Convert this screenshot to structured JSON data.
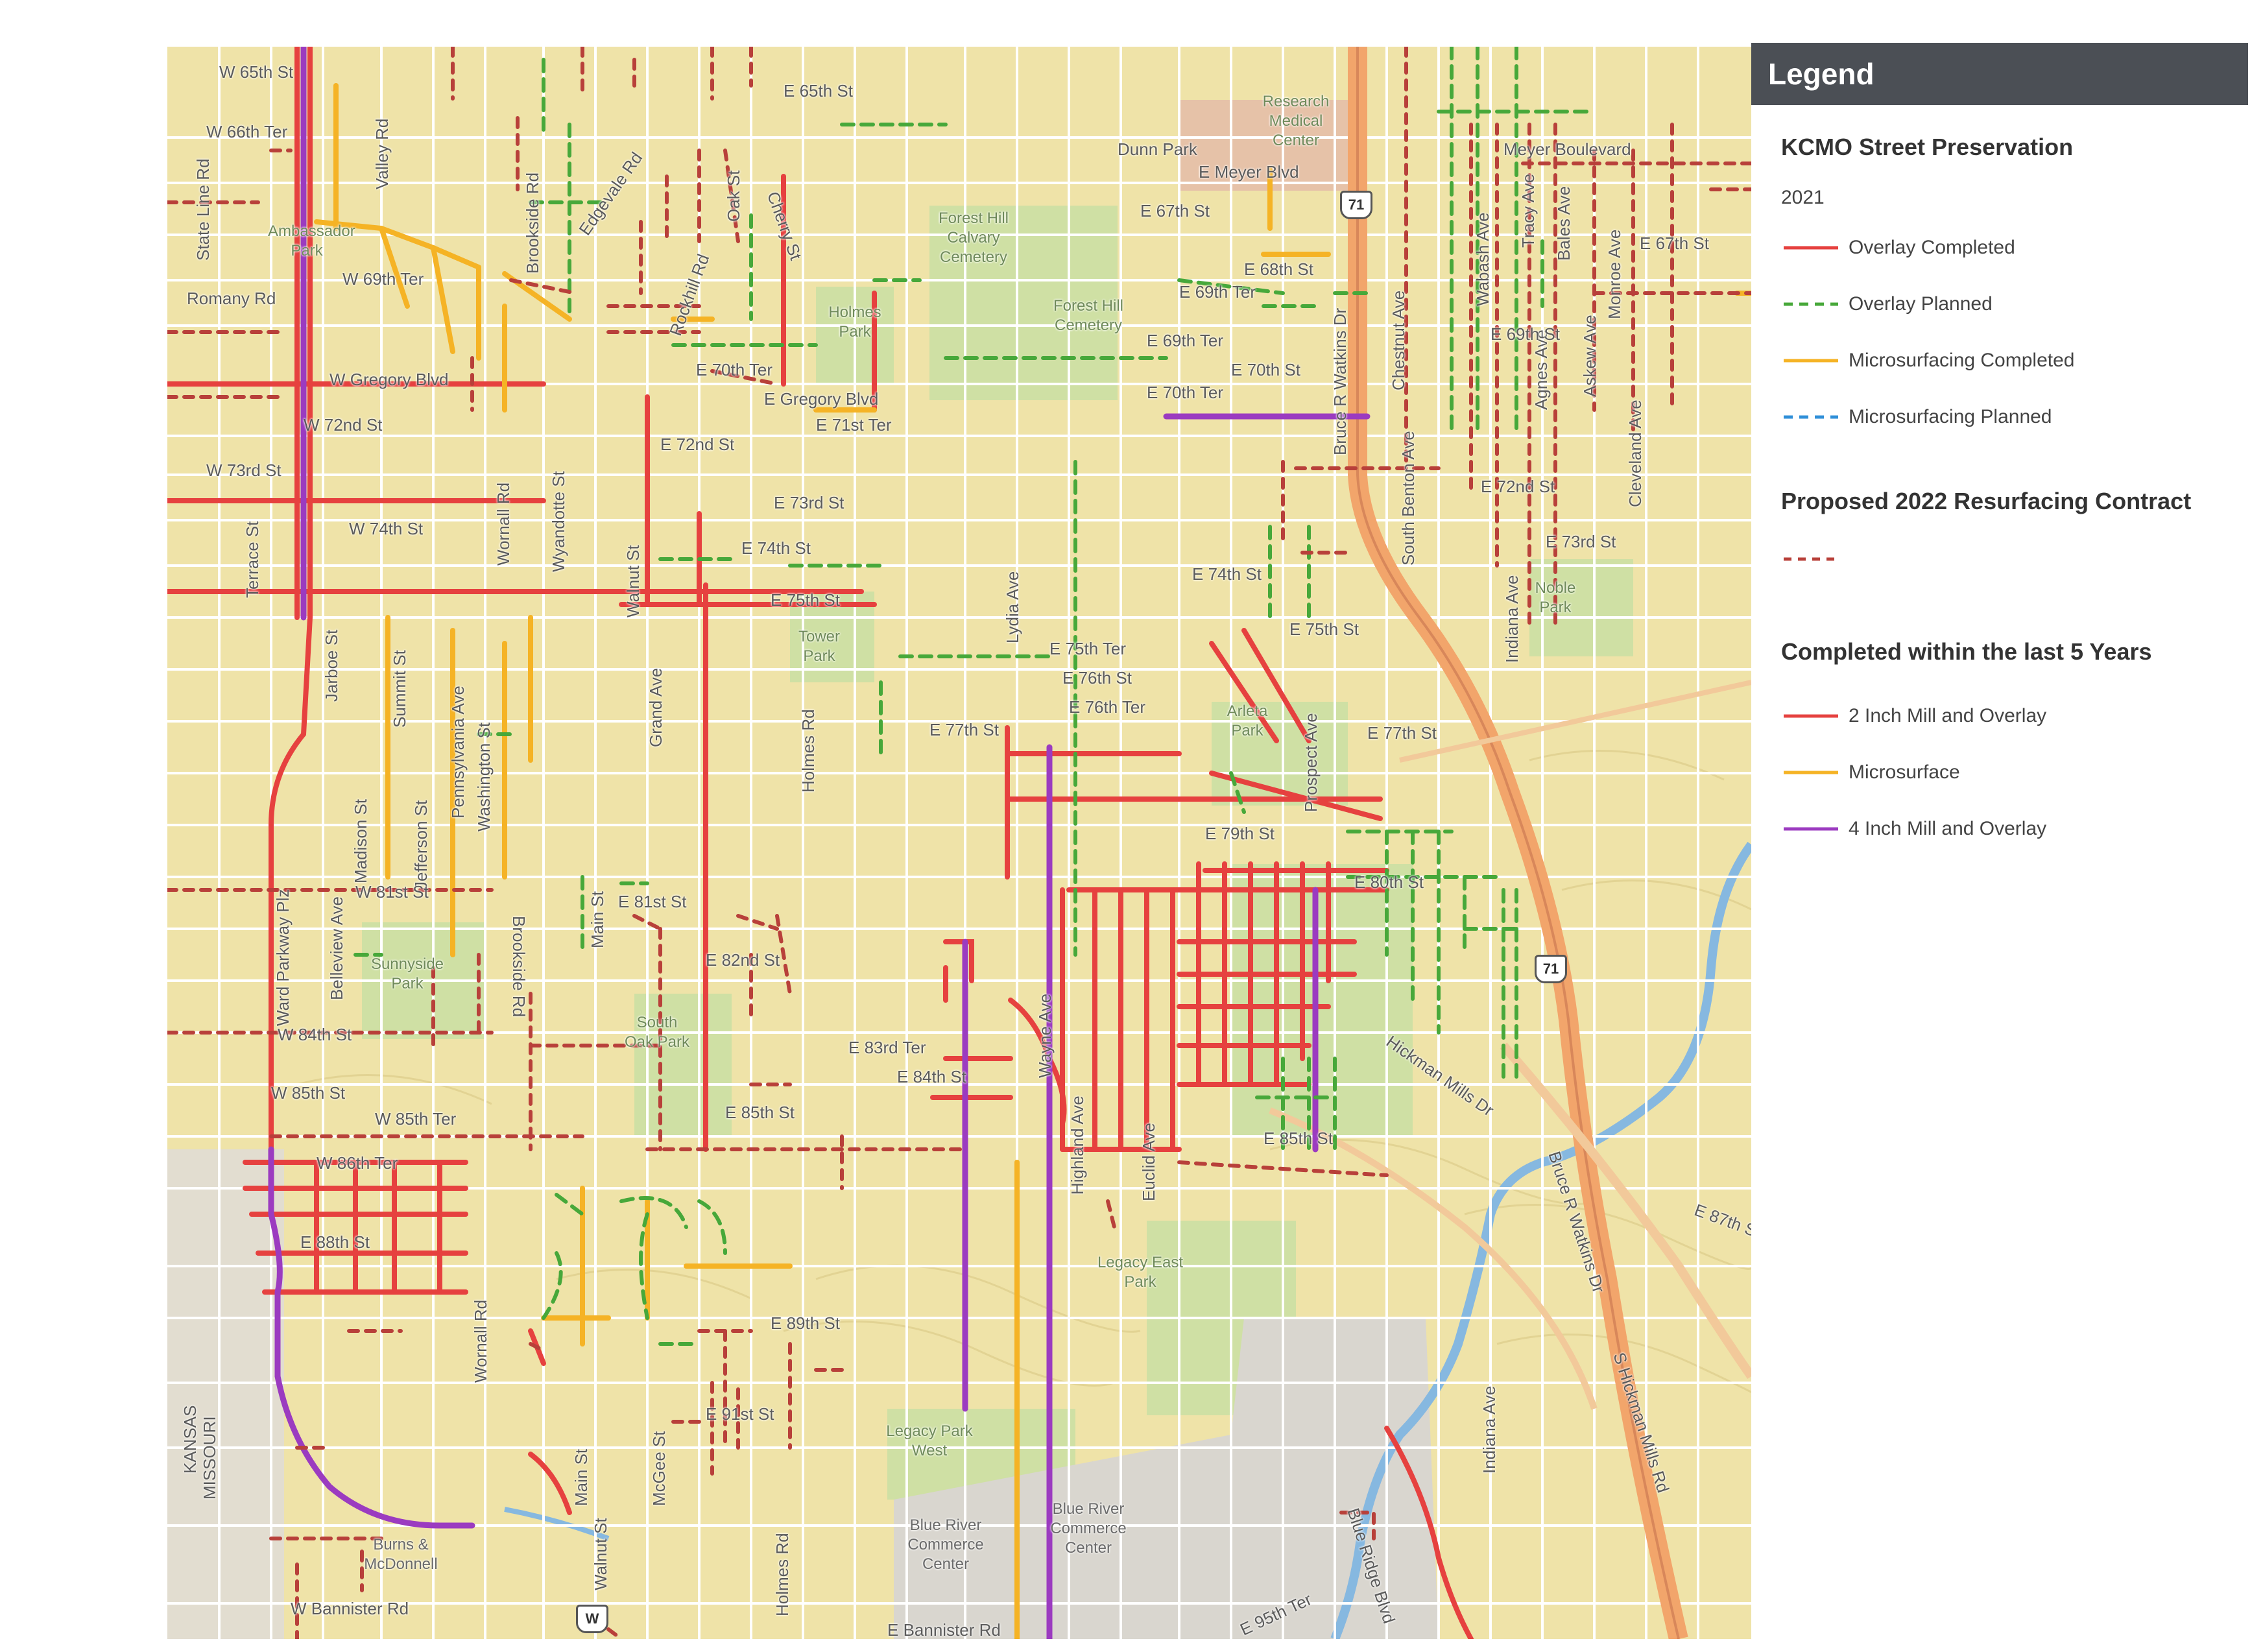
{
  "legend": {
    "header": "Legend",
    "sections": [
      {
        "title": "KCMO Street Preservation",
        "subtitle": "2021",
        "items": [
          {
            "label": "Overlay Completed",
            "color": "#e6413f",
            "style": "solid"
          },
          {
            "label": "Overlay Planned",
            "color": "#47a83a",
            "style": "dashed"
          },
          {
            "label": "Microsurfacing Completed",
            "color": "#f5b325",
            "style": "solid"
          },
          {
            "label": "Microsurfacing Planned",
            "color": "#2f8fd8",
            "style": "dashed"
          }
        ]
      },
      {
        "title": "Proposed 2022 Resurfacing Contract",
        "subtitle": "",
        "items": [
          {
            "label": "",
            "color": "#b8403a",
            "style": "dashed"
          }
        ]
      },
      {
        "title": "Completed within the last 5 Years",
        "subtitle": "",
        "items": [
          {
            "label": "2 Inch Mill and Overlay",
            "color": "#e6413f",
            "style": "solid"
          },
          {
            "label": "Microsurface",
            "color": "#f5b325",
            "style": "solid"
          },
          {
            "label": "4 Inch Mill and Overlay",
            "color": "#9b3bc0",
            "style": "solid"
          }
        ]
      }
    ]
  },
  "map": {
    "colors": {
      "land": "#efe3a8",
      "park": "#cfe0a4",
      "road": "#ffffff",
      "highway": "#f2a56b",
      "commerce": "#d9d6cf",
      "river": "#86b8e0"
    },
    "street_labels": [
      "W 65th St",
      "W 66th Ter",
      "Valley Rd",
      "State Line Rd",
      "Brookside Rd",
      "Edgevale Rd",
      "Oak St",
      "Cherry St",
      "E 65th St",
      "Dunn Park",
      "E Meyer Blvd",
      "Meyer Boulevard",
      "E 67th St",
      "E 68th St",
      "E 69th Ter",
      "E 69th Ter",
      "E 70th St",
      "E 70th Ter",
      "Bruce R Watkins Dr",
      "Chestnut Ave",
      "Wabash Ave",
      "Bales Ave",
      "Monroe Ave",
      "Askew Ave",
      "Cleveland Ave",
      "E 67th St",
      "Romany Rd",
      "W 69th Ter",
      "Rockhill Rd",
      "E 70th Ter",
      "W Gregory Blvd",
      "E Gregory Blvd",
      "E 71st Ter",
      "W 72nd St",
      "W 73rd St",
      "E 72nd St",
      "E 73rd St",
      "E 74th St",
      "E 75th St",
      "Terrace St",
      "W 74th St",
      "Wornall Rd",
      "Wyandotte St",
      "Walnut St",
      "Lydia Ave",
      "E 74th St",
      "E 75th St",
      "E 72nd St",
      "E 73rd St",
      "Indiana Ave",
      "Jarboe St",
      "Summit St",
      "Pennsylvania Ave",
      "Washington St",
      "Grand Ave",
      "Holmes Rd",
      "E 75th Ter",
      "E 76th St",
      "E 76th Ter",
      "E 77th St",
      "Prospect Ave",
      "E 77th St",
      "Madison St",
      "Jefferson St",
      "Brookside Rd",
      "Main St",
      "E 81st St",
      "E 82nd St",
      "Ward Parkway Plz",
      "Belleview Ave",
      "W 81st St",
      "E 79th St",
      "E 80th St",
      "W 84th St",
      "W 85th St",
      "W 85th Ter",
      "W 86th Ter",
      "E 85th St",
      "E 83rd Ter",
      "E 84th St",
      "Wayne Ave",
      "Highland Ave",
      "Euclid Ave",
      "Hickman Mills Dr",
      "E 85th St",
      "Bruce R Watkins Dr",
      "E 87th St",
      "E 88th St",
      "E 89th St",
      "E 91st St",
      "McGee St",
      "Main St",
      "Walnut St",
      "Wornall Rd",
      "Holmes Rd",
      "Indiana Ave",
      "S Hickman Mills Rd",
      "Blue Ridge Blvd",
      "E 95th Ter",
      "W Bannister Rd",
      "E Bannister Rd",
      "KANSAS",
      "MISSOURI",
      "Agnes Ave",
      "South Benton Ave",
      "E 69th St",
      "Tracy Ave"
    ],
    "park_labels": [
      "Research Medical Center",
      "Forest Hill Calvary Cemetery",
      "Holmes Park",
      "Forest Hill Cemetery",
      "Tower Park",
      "Arleta Park",
      "Noble Park",
      "Sunnyside Park",
      "South Oak Park",
      "Legacy East Park",
      "Legacy Park West",
      "Blue River Commerce Center",
      "Blue River Commerce Center",
      "Burns & McDonnell",
      "Ambassador Park"
    ],
    "shields": [
      "71",
      "71",
      "W"
    ]
  }
}
